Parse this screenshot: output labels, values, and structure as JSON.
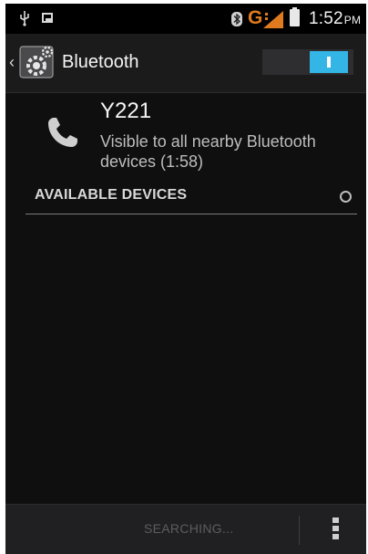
{
  "status_bar": {
    "time": "1:52",
    "ampm": "PM",
    "network_type": "G",
    "icons": [
      "usb-icon",
      "image-icon",
      "bluetooth-icon",
      "signal-icon",
      "battery-icon"
    ]
  },
  "action_bar": {
    "title": "Bluetooth",
    "icon": "bluetooth-settings-icon",
    "toggle_state": "on",
    "toggle_label": "I",
    "accent": "#33b5e5"
  },
  "device": {
    "name": "Y221",
    "visibility": "Visible to all nearby Bluetooth devices (1:58)",
    "icon": "phone-icon"
  },
  "section": {
    "title": "AVAILABLE DEVICES",
    "progress_icon": "spinner-icon"
  },
  "bottom_bar": {
    "search_label": "SEARCHING...",
    "menu_icon": "overflow-menu-icon"
  }
}
